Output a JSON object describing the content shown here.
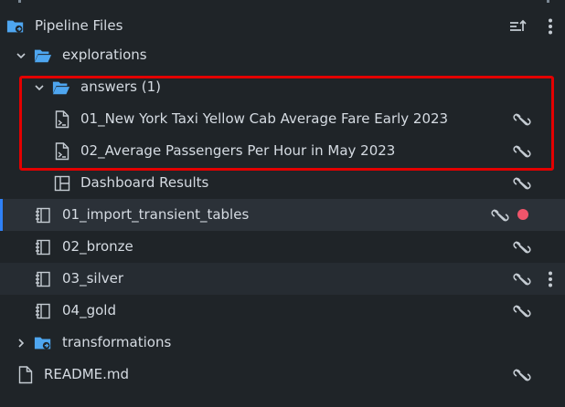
{
  "root": {
    "title": "Pipeline Files",
    "icon": "pipeline-folder-icon"
  },
  "explorations": {
    "label": "explorations",
    "icon": "folder-open-icon"
  },
  "answers": {
    "label": "answers (1)",
    "icon": "folder-open-icon",
    "items": [
      {
        "label": "01_New York Taxi Yellow Cab Average Fare Early 2023",
        "icon": "query-file-icon"
      },
      {
        "label": "02_Average Passengers Per Hour in May 2023",
        "icon": "query-file-icon"
      }
    ]
  },
  "dashboard": {
    "label": "Dashboard Results",
    "icon": "dashboard-icon"
  },
  "notebooks": [
    {
      "label": "01_import_transient_tables",
      "icon": "notebook-icon"
    },
    {
      "label": "02_bronze",
      "icon": "notebook-icon"
    },
    {
      "label": "03_silver",
      "icon": "notebook-icon"
    },
    {
      "label": "04_gold",
      "icon": "notebook-icon"
    }
  ],
  "transformations": {
    "label": "transformations",
    "icon": "pipeline-folder-icon"
  },
  "readme": {
    "label": "README.md",
    "icon": "file-icon"
  },
  "colors": {
    "background": "#1f2428",
    "selected_row": "#2b3138",
    "folder_blue": "#4ea6f0",
    "highlight_border": "#e30000",
    "modified_dot": "#f0556b"
  }
}
